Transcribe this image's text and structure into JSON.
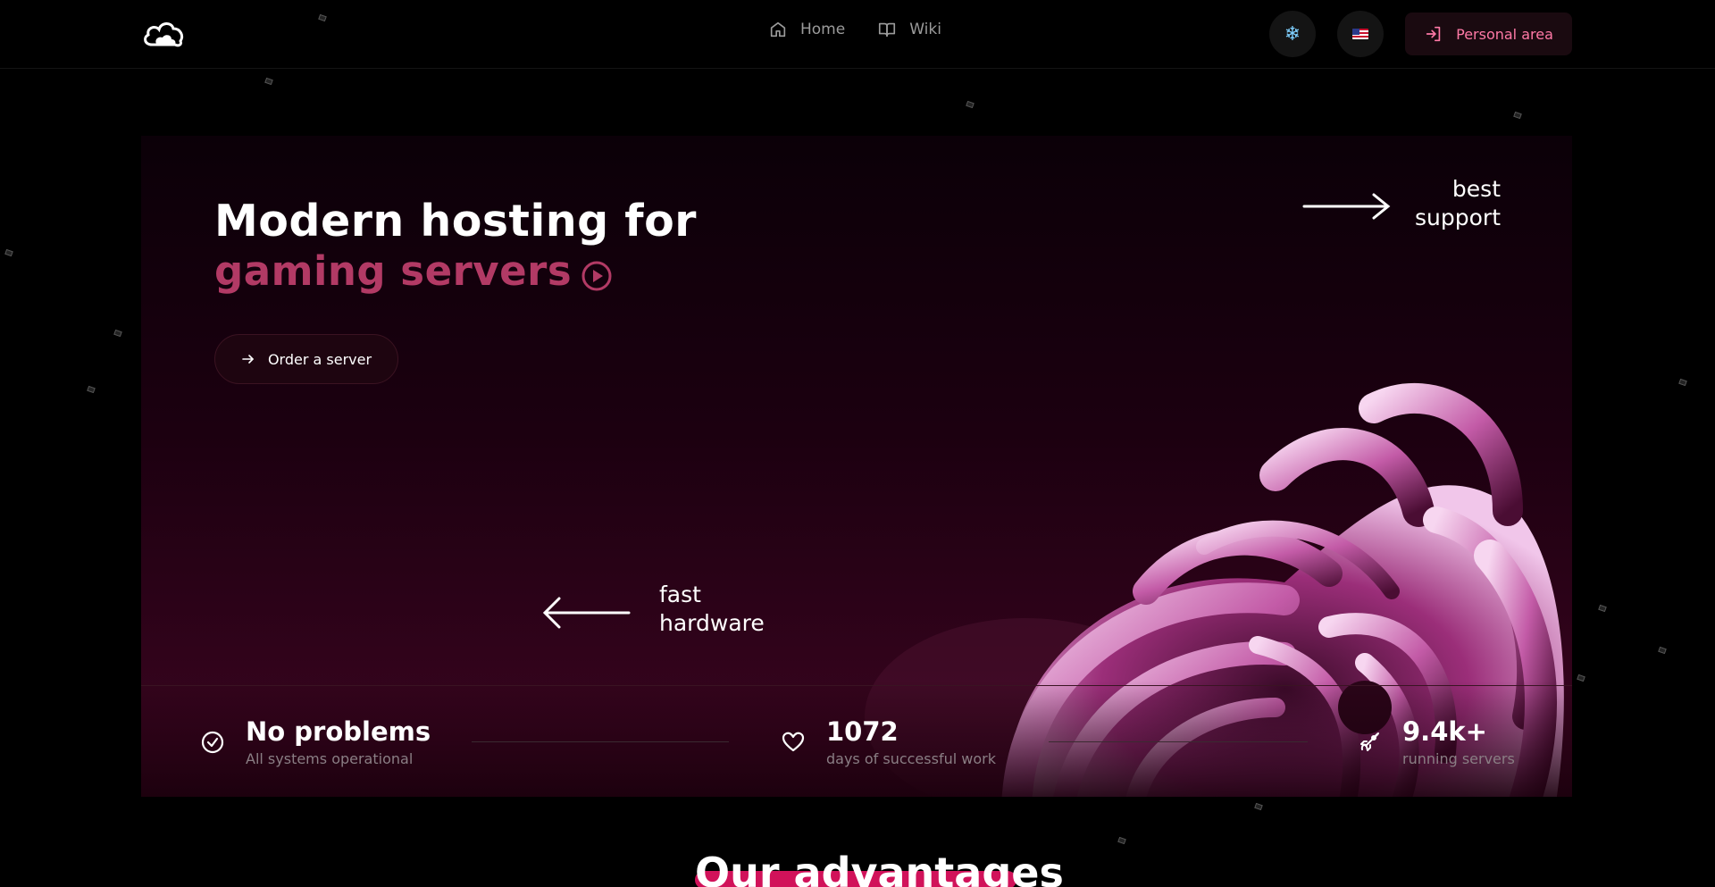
{
  "header": {
    "logo_icon": "cloud-logo-icon",
    "nav": [
      {
        "label": "Home",
        "icon": "home-icon"
      },
      {
        "label": "Wiki",
        "icon": "book-icon"
      }
    ],
    "snow_icon": "❄",
    "personal_area": "Personal area"
  },
  "hero": {
    "title_line1": "Modern hosting for",
    "title_line2": "gaming servers",
    "order_button": "Order a server",
    "best_support_line1": "best",
    "best_support_line2": "support",
    "fast_hardware_line1": "fast",
    "fast_hardware_line2": "hardware"
  },
  "stats": [
    {
      "value": "No problems",
      "label": "All systems operational",
      "icon": "check-circle-icon"
    },
    {
      "value": "1072",
      "label": "days of successful work",
      "icon": "heart-icon"
    },
    {
      "value": "9.4k+",
      "label": "running servers",
      "icon": "rocket-icon"
    }
  ],
  "advantages": {
    "title": "Our advantages"
  },
  "colors": {
    "accent": "#ff79a6",
    "brand": "#b23a65",
    "background": "#000000"
  }
}
